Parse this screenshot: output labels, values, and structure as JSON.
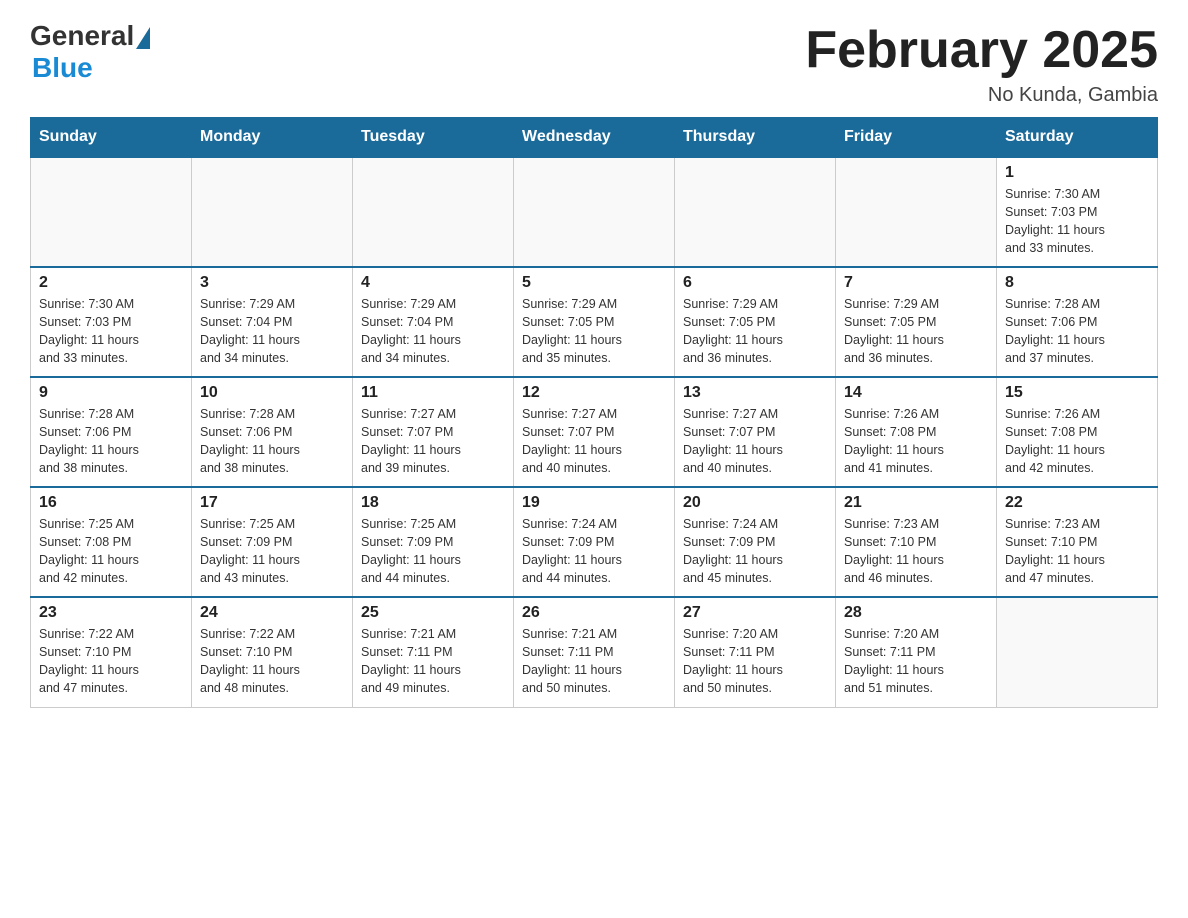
{
  "logo": {
    "general": "General",
    "blue": "Blue"
  },
  "title": "February 2025",
  "location": "No Kunda, Gambia",
  "days_of_week": [
    "Sunday",
    "Monday",
    "Tuesday",
    "Wednesday",
    "Thursday",
    "Friday",
    "Saturday"
  ],
  "weeks": [
    [
      {
        "day": "",
        "info": ""
      },
      {
        "day": "",
        "info": ""
      },
      {
        "day": "",
        "info": ""
      },
      {
        "day": "",
        "info": ""
      },
      {
        "day": "",
        "info": ""
      },
      {
        "day": "",
        "info": ""
      },
      {
        "day": "1",
        "info": "Sunrise: 7:30 AM\nSunset: 7:03 PM\nDaylight: 11 hours\nand 33 minutes."
      }
    ],
    [
      {
        "day": "2",
        "info": "Sunrise: 7:30 AM\nSunset: 7:03 PM\nDaylight: 11 hours\nand 33 minutes."
      },
      {
        "day": "3",
        "info": "Sunrise: 7:29 AM\nSunset: 7:04 PM\nDaylight: 11 hours\nand 34 minutes."
      },
      {
        "day": "4",
        "info": "Sunrise: 7:29 AM\nSunset: 7:04 PM\nDaylight: 11 hours\nand 34 minutes."
      },
      {
        "day": "5",
        "info": "Sunrise: 7:29 AM\nSunset: 7:05 PM\nDaylight: 11 hours\nand 35 minutes."
      },
      {
        "day": "6",
        "info": "Sunrise: 7:29 AM\nSunset: 7:05 PM\nDaylight: 11 hours\nand 36 minutes."
      },
      {
        "day": "7",
        "info": "Sunrise: 7:29 AM\nSunset: 7:05 PM\nDaylight: 11 hours\nand 36 minutes."
      },
      {
        "day": "8",
        "info": "Sunrise: 7:28 AM\nSunset: 7:06 PM\nDaylight: 11 hours\nand 37 minutes."
      }
    ],
    [
      {
        "day": "9",
        "info": "Sunrise: 7:28 AM\nSunset: 7:06 PM\nDaylight: 11 hours\nand 38 minutes."
      },
      {
        "day": "10",
        "info": "Sunrise: 7:28 AM\nSunset: 7:06 PM\nDaylight: 11 hours\nand 38 minutes."
      },
      {
        "day": "11",
        "info": "Sunrise: 7:27 AM\nSunset: 7:07 PM\nDaylight: 11 hours\nand 39 minutes."
      },
      {
        "day": "12",
        "info": "Sunrise: 7:27 AM\nSunset: 7:07 PM\nDaylight: 11 hours\nand 40 minutes."
      },
      {
        "day": "13",
        "info": "Sunrise: 7:27 AM\nSunset: 7:07 PM\nDaylight: 11 hours\nand 40 minutes."
      },
      {
        "day": "14",
        "info": "Sunrise: 7:26 AM\nSunset: 7:08 PM\nDaylight: 11 hours\nand 41 minutes."
      },
      {
        "day": "15",
        "info": "Sunrise: 7:26 AM\nSunset: 7:08 PM\nDaylight: 11 hours\nand 42 minutes."
      }
    ],
    [
      {
        "day": "16",
        "info": "Sunrise: 7:25 AM\nSunset: 7:08 PM\nDaylight: 11 hours\nand 42 minutes."
      },
      {
        "day": "17",
        "info": "Sunrise: 7:25 AM\nSunset: 7:09 PM\nDaylight: 11 hours\nand 43 minutes."
      },
      {
        "day": "18",
        "info": "Sunrise: 7:25 AM\nSunset: 7:09 PM\nDaylight: 11 hours\nand 44 minutes."
      },
      {
        "day": "19",
        "info": "Sunrise: 7:24 AM\nSunset: 7:09 PM\nDaylight: 11 hours\nand 44 minutes."
      },
      {
        "day": "20",
        "info": "Sunrise: 7:24 AM\nSunset: 7:09 PM\nDaylight: 11 hours\nand 45 minutes."
      },
      {
        "day": "21",
        "info": "Sunrise: 7:23 AM\nSunset: 7:10 PM\nDaylight: 11 hours\nand 46 minutes."
      },
      {
        "day": "22",
        "info": "Sunrise: 7:23 AM\nSunset: 7:10 PM\nDaylight: 11 hours\nand 47 minutes."
      }
    ],
    [
      {
        "day": "23",
        "info": "Sunrise: 7:22 AM\nSunset: 7:10 PM\nDaylight: 11 hours\nand 47 minutes."
      },
      {
        "day": "24",
        "info": "Sunrise: 7:22 AM\nSunset: 7:10 PM\nDaylight: 11 hours\nand 48 minutes."
      },
      {
        "day": "25",
        "info": "Sunrise: 7:21 AM\nSunset: 7:11 PM\nDaylight: 11 hours\nand 49 minutes."
      },
      {
        "day": "26",
        "info": "Sunrise: 7:21 AM\nSunset: 7:11 PM\nDaylight: 11 hours\nand 50 minutes."
      },
      {
        "day": "27",
        "info": "Sunrise: 7:20 AM\nSunset: 7:11 PM\nDaylight: 11 hours\nand 50 minutes."
      },
      {
        "day": "28",
        "info": "Sunrise: 7:20 AM\nSunset: 7:11 PM\nDaylight: 11 hours\nand 51 minutes."
      },
      {
        "day": "",
        "info": ""
      }
    ]
  ]
}
